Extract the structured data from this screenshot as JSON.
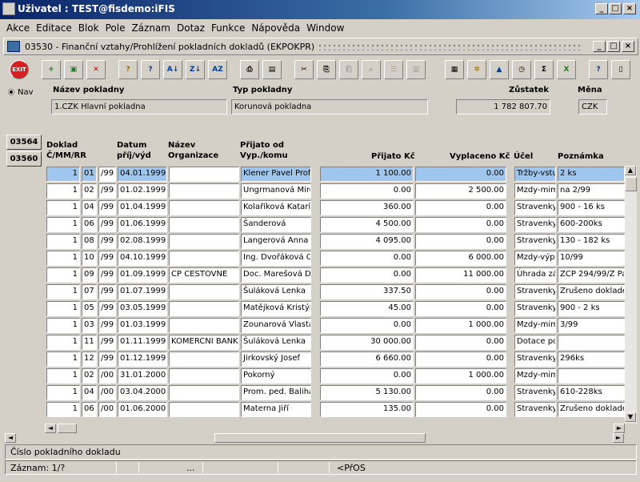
{
  "window": {
    "title": "Uživatel : TEST@fisdemo:iFIS"
  },
  "menu": [
    "Akce",
    "Editace",
    "Blok",
    "Pole",
    "Záznam",
    "Dotaz",
    "Funkce",
    "Nápověda",
    "Window"
  ],
  "form": {
    "title": "03530 - Finanční vztahy/Prohlížení pokladních dokladů (EKPOKPR)"
  },
  "toolbar": {
    "exit_label": "EXIT"
  },
  "nav_label": "Nav",
  "header": {
    "nazev_label": "Název pokladny",
    "nazev_value": "1.CZK Hlavní pokladna",
    "typ_label": "Typ pokladny",
    "typ_value": "Korunová pokladna",
    "zustatek_label": "Zůstatek",
    "zustatek_value": "1 782 807.70",
    "mena_label": "Měna",
    "mena_value": "CZK"
  },
  "tabs": [
    "03564",
    "03560"
  ],
  "columns": {
    "doklad": "Doklad",
    "cmmrr": "Č/MM/RR",
    "datum": "Datum",
    "prijvyd": "příj/výd",
    "nazev": "Název",
    "organizace": "Organizace",
    "prijato_od": "Přijato od",
    "vyp_komu": "Vyp./komu",
    "prijato_kc": "Přijato Kč",
    "vyplaceno_kc": "Vyplaceno Kč",
    "ucel": "Účel",
    "poznamka": "Poznámka"
  },
  "rows": [
    {
      "c": "1",
      "mm": "01",
      "rr": "/99",
      "datum": "04.01.1999",
      "org": "",
      "osoba": "Klener Pavel Prof.",
      "prijato": "1 100.00",
      "vyplaceno": "0.00",
      "ucel": "Tržby-vstu",
      "pozn": "2 ks"
    },
    {
      "c": "1",
      "mm": "02",
      "rr": "/99",
      "datum": "01.02.1999",
      "org": "",
      "osoba": "Ungrmanová Miros",
      "prijato": "0.00",
      "vyplaceno": "2 500.00",
      "ucel": "Mzdy-mim",
      "pozn": "na 2/99"
    },
    {
      "c": "1",
      "mm": "04",
      "rr": "/99",
      "datum": "01.04.1999",
      "org": "",
      "osoba": "Kolaříková Katarín",
      "prijato": "360.00",
      "vyplaceno": "0.00",
      "ucel": "Stravenky",
      "pozn": "900 - 16 ks"
    },
    {
      "c": "1",
      "mm": "06",
      "rr": "/99",
      "datum": "01.06.1999",
      "org": "",
      "osoba": "Šanderová",
      "prijato": "4 500.00",
      "vyplaceno": "0.00",
      "ucel": "Stravenky",
      "pozn": "600-200ks"
    },
    {
      "c": "1",
      "mm": "08",
      "rr": "/99",
      "datum": "02.08.1999",
      "org": "",
      "osoba": "Langerová Anna",
      "prijato": "4 095.00",
      "vyplaceno": "0.00",
      "ucel": "Stravenky",
      "pozn": "130 - 182 ks"
    },
    {
      "c": "1",
      "mm": "10",
      "rr": "/99",
      "datum": "04.10.1999",
      "org": "",
      "osoba": "Ing. Dvořáková Ol",
      "prijato": "0.00",
      "vyplaceno": "6 000.00",
      "ucel": "Mzdy-výpl",
      "pozn": "10/99"
    },
    {
      "c": "1",
      "mm": "09",
      "rr": "/99",
      "datum": "01.09.1999",
      "org": "CP CESTOVNE",
      "osoba": "Doc. Marešová Da",
      "prijato": "0.00",
      "vyplaceno": "11 000.00",
      "ucel": "Úhrada zá",
      "pozn": "ZCP 294/99/Z Pai"
    },
    {
      "c": "1",
      "mm": "07",
      "rr": "/99",
      "datum": "01.07.1999",
      "org": "",
      "osoba": "Šuláková Lenka",
      "prijato": "337.50",
      "vyplaceno": "0.00",
      "ucel": "Stravenky",
      "pozn": "Zrušeno doklader"
    },
    {
      "c": "1",
      "mm": "05",
      "rr": "/99",
      "datum": "03.05.1999",
      "org": "",
      "osoba": "Matějková Kristýn",
      "prijato": "45.00",
      "vyplaceno": "0.00",
      "ucel": "Stravenky",
      "pozn": "900 - 2 ks"
    },
    {
      "c": "1",
      "mm": "03",
      "rr": "/99",
      "datum": "01.03.1999",
      "org": "",
      "osoba": "Zounarová Vlasta",
      "prijato": "0.00",
      "vyplaceno": "1 000.00",
      "ucel": "Mzdy-mim",
      "pozn": "3/99"
    },
    {
      "c": "1",
      "mm": "11",
      "rr": "/99",
      "datum": "01.11.1999",
      "org": "KOMERCNI BANK.",
      "osoba": "Šuláková Lenka",
      "prijato": "30 000.00",
      "vyplaceno": "0.00",
      "ucel": "Dotace po",
      "pozn": ""
    },
    {
      "c": "1",
      "mm": "12",
      "rr": "/99",
      "datum": "01.12.1999",
      "org": "",
      "osoba": "Jirkovský Josef",
      "prijato": "6 660.00",
      "vyplaceno": "0.00",
      "ucel": "Stravenky",
      "pozn": "296ks"
    },
    {
      "c": "1",
      "mm": "02",
      "rr": "/00",
      "datum": "31.01.2000",
      "org": "",
      "osoba": "Pokorný",
      "prijato": "0.00",
      "vyplaceno": "1 000.00",
      "ucel": "Mzdy-mim",
      "pozn": ""
    },
    {
      "c": "1",
      "mm": "04",
      "rr": "/00",
      "datum": "03.04.2000",
      "org": "",
      "osoba": "Prom. ped. Baliha",
      "prijato": "5 130.00",
      "vyplaceno": "0.00",
      "ucel": "Stravenky",
      "pozn": "610-228ks"
    },
    {
      "c": "1",
      "mm": "06",
      "rr": "/00",
      "datum": "01.06.2000",
      "org": "",
      "osoba": "Materna Jiří",
      "prijato": "135.00",
      "vyplaceno": "0.00",
      "ucel": "Stravenky",
      "pozn": "Zrušeno doklader"
    }
  ],
  "status": {
    "hint": "Číslo pokladního dokladu",
    "record": "Záznam: 1/?",
    "dots": "...",
    "mode": "<PřOS"
  }
}
